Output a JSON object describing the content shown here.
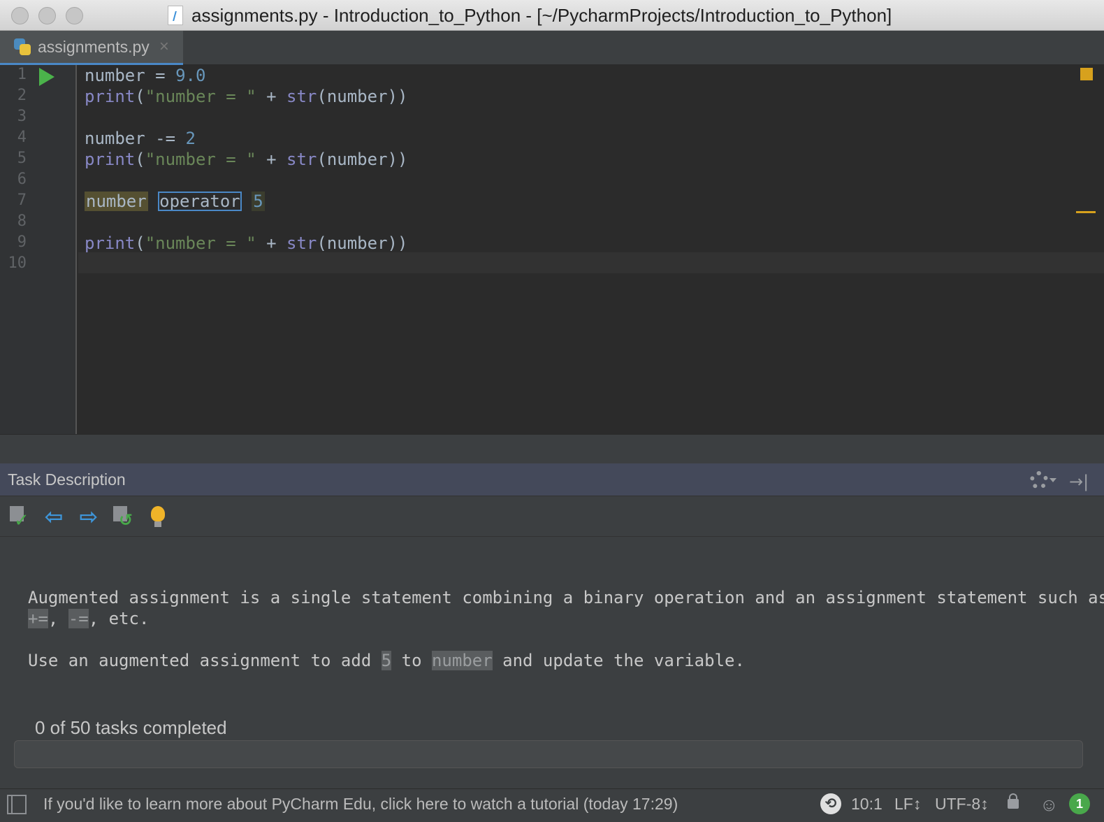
{
  "window": {
    "title": "assignments.py - Introduction_to_Python - [~/PycharmProjects/Introduction_to_Python]"
  },
  "tabs": [
    {
      "label": "assignments.py",
      "close": "×"
    }
  ],
  "editor": {
    "line_numbers": [
      "1",
      "2",
      "3",
      "4",
      "5",
      "6",
      "7",
      "8",
      "9",
      "10"
    ],
    "lines": [
      {
        "var": "number",
        "op": " = ",
        "num": "9.0"
      },
      {
        "fn": "print",
        "open": "(",
        "str": "\"number = \"",
        "plus": " + ",
        "fn2": "str",
        "arg": "(number))"
      },
      {},
      {
        "var": "number",
        "op": " -= ",
        "num": "2"
      },
      {
        "fn": "print",
        "open": "(",
        "str": "\"number = \"",
        "plus": " + ",
        "fn2": "str",
        "arg": "(number))"
      },
      {},
      {
        "ph1": "number",
        "ph2": "operator",
        "ph3": "5"
      },
      {},
      {
        "fn": "print",
        "open": "(",
        "str": "\"number = \"",
        "plus": " + ",
        "fn2": "str",
        "arg": "(number))"
      },
      {}
    ]
  },
  "task_panel": {
    "title": "Task Description",
    "desc_line1": "Augmented assignment is a single statement combining a binary operation and an assignment statement such as",
    "chip1": "+=",
    "sep1": ", ",
    "chip2": "-=",
    "tail1": ", etc.",
    "desc2_a": "Use an augmented assignment to add ",
    "chip3": "5",
    "desc2_b": " to ",
    "chip4": "number",
    "desc2_c": " and update the variable.",
    "progress_label": "0 of 50 tasks completed",
    "progress_fraction": 0.0
  },
  "statusbar": {
    "message": "If you'd like to learn more about PyCharm Edu, click here to watch a tutorial (today 17:29)",
    "position": "10:1",
    "line_sep": "LF↕",
    "encoding": "UTF-8↕",
    "event_count": "1"
  },
  "colors": {
    "accent": "#4a88c7",
    "run_green": "#4bb34b",
    "warning": "#d7a11d"
  }
}
